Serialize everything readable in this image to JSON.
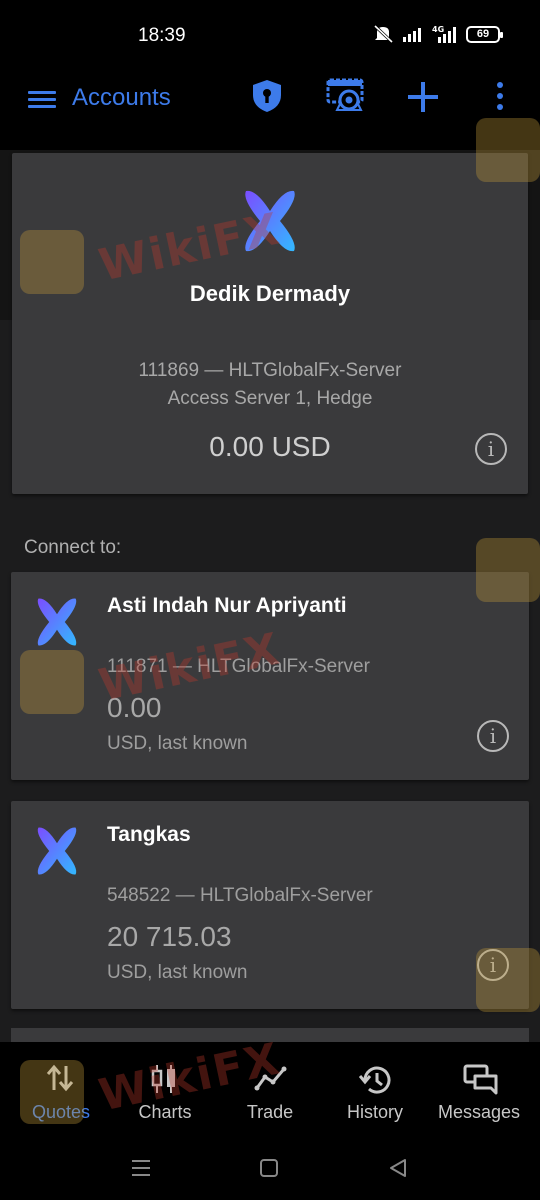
{
  "status": {
    "time": "18:39",
    "network": "4G",
    "battery": "69"
  },
  "appbar": {
    "title": "Accounts"
  },
  "main_account": {
    "name": "Dedik Dermady",
    "server": "111869 — HLTGlobalFx-Server",
    "access": "Access Server 1, Hedge",
    "balance": "0.00 USD"
  },
  "section_label": "Connect to:",
  "accounts": [
    {
      "name": "Asti Indah Nur Apriyanti",
      "server": "111871 — HLTGlobalFx-Server",
      "balance": "0.00",
      "currency": "USD, last known"
    },
    {
      "name": "Tangkas",
      "server": "548522 — HLTGlobalFx-Server",
      "balance": "20 715.03",
      "currency": "USD, last known"
    }
  ],
  "nav": [
    {
      "label": "Quotes",
      "icon": "quotes-icon"
    },
    {
      "label": "Charts",
      "icon": "charts-icon"
    },
    {
      "label": "Trade",
      "icon": "trade-icon"
    },
    {
      "label": "History",
      "icon": "history-icon"
    },
    {
      "label": "Messages",
      "icon": "messages-icon"
    }
  ],
  "watermark": "WikiFX",
  "colors": {
    "accent": "#3d7bea",
    "card": "#3a3a3c",
    "background": "#1c1c1d"
  }
}
